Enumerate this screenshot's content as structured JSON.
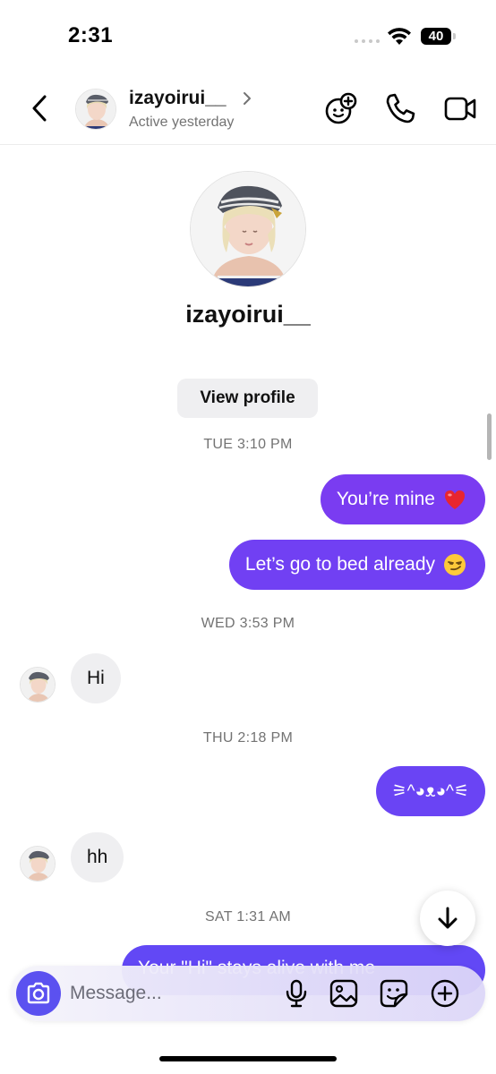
{
  "status_bar": {
    "time": "2:31",
    "battery": "40"
  },
  "header": {
    "username": "izayoirui__",
    "status": "Active yesterday",
    "icons": [
      "back-icon",
      "chevron-right-icon",
      "effects-icon",
      "phone-icon",
      "video-icon"
    ]
  },
  "profile": {
    "username": "izayoirui__",
    "view_profile_label": "View profile"
  },
  "messages": [
    {
      "type": "timestamp",
      "text": "TUE 3:10 PM"
    },
    {
      "type": "outgoing",
      "text": "You’re mine",
      "emoji": "red-heart"
    },
    {
      "type": "outgoing",
      "text": "Let’s go to bed already",
      "emoji": "smirking-face"
    },
    {
      "type": "timestamp",
      "text": "WED 3:53 PM"
    },
    {
      "type": "incoming",
      "text": "Hi"
    },
    {
      "type": "timestamp",
      "text": "THU 2:18 PM"
    },
    {
      "type": "outgoing",
      "text": "⚞^◕ᴥ◕^⚟"
    },
    {
      "type": "incoming",
      "text": "hh"
    },
    {
      "type": "timestamp",
      "text": "SAT 1:31 AM"
    },
    {
      "type": "outgoing",
      "text": "Your \"Hi\" stays alive with me"
    }
  ],
  "composer": {
    "placeholder": "Message...",
    "icons": [
      "camera-icon",
      "microphone-icon",
      "gallery-icon",
      "sticker-icon",
      "add-icon"
    ]
  },
  "colors": {
    "bubble_out": "#7a3cf1",
    "bubble_in": "#efeff1",
    "camera_button": "#5b51f0",
    "timestamp": "#737373"
  }
}
